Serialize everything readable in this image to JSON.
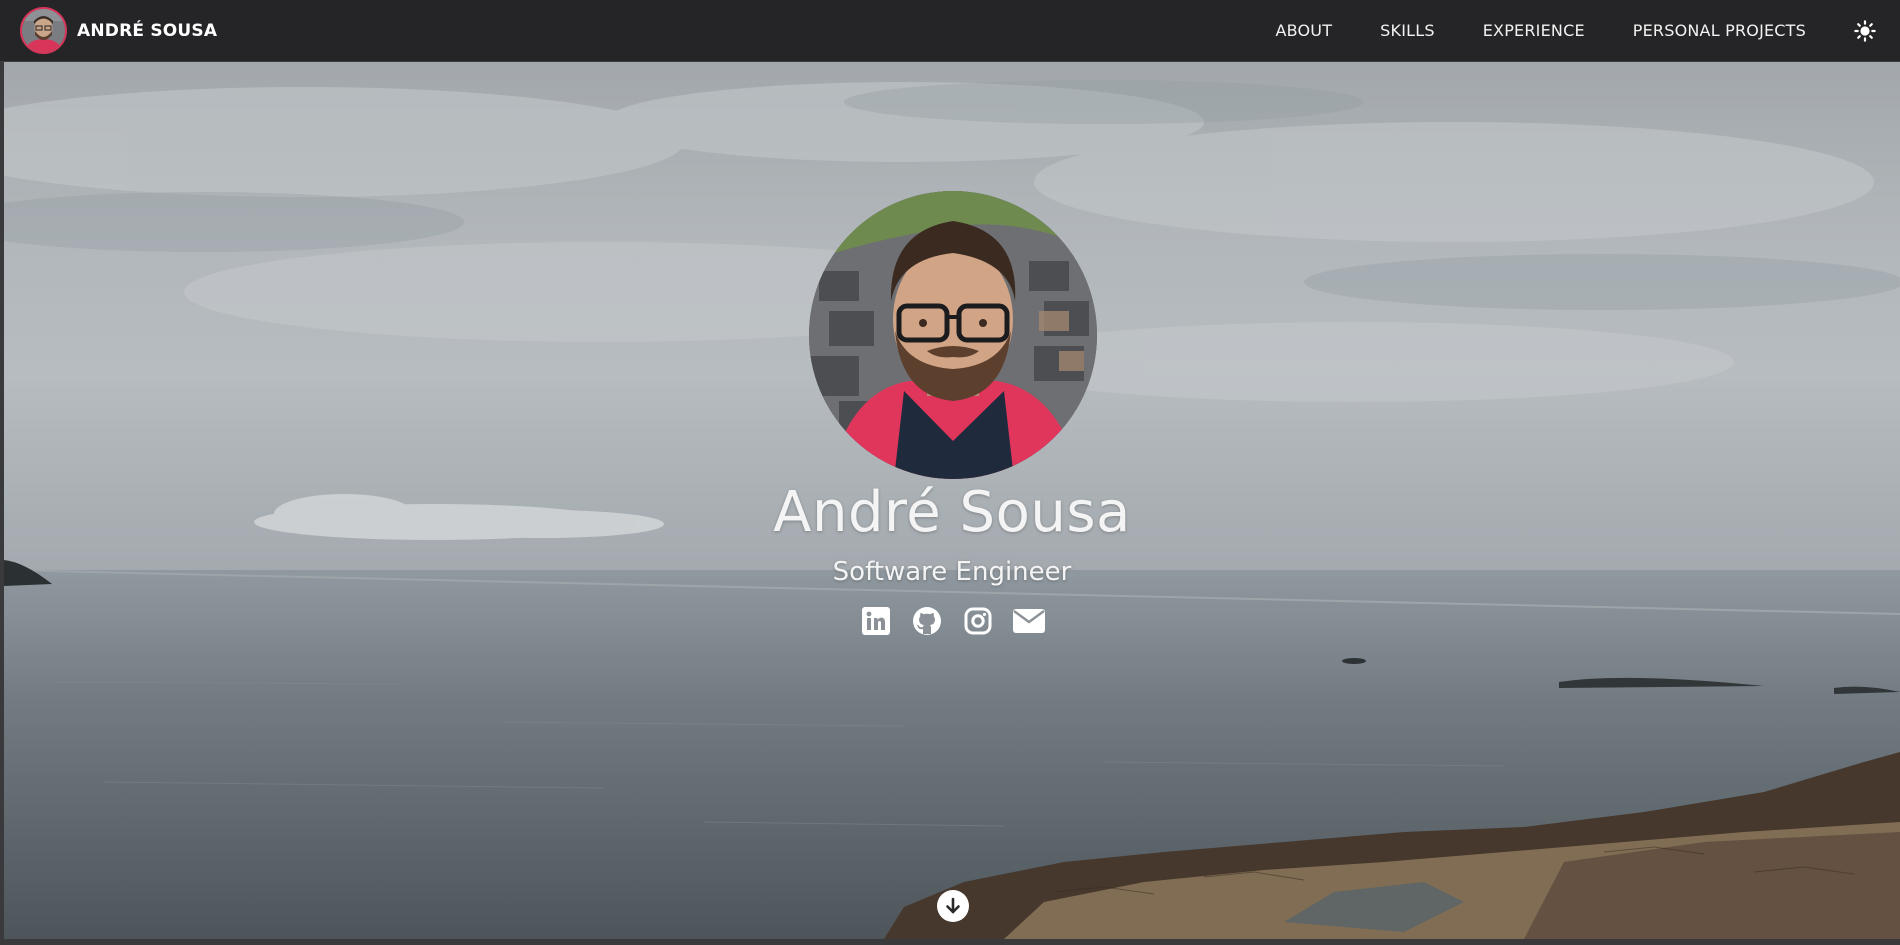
{
  "navbar": {
    "brand_name": "ANDRÉ SOUSA",
    "links": [
      {
        "label": "ABOUT"
      },
      {
        "label": "SKILLS"
      },
      {
        "label": "EXPERIENCE"
      },
      {
        "label": "PERSONAL PROJECTS"
      }
    ],
    "theme_toggle_icon": "sun-icon"
  },
  "hero": {
    "name": "André Sousa",
    "role": "Software Engineer",
    "social_icons": [
      "linkedin-icon",
      "github-icon",
      "instagram-icon",
      "envelope-icon"
    ],
    "scroll_icon": "arrow-down-icon"
  },
  "colors": {
    "navbar_bg": "#252527",
    "accent_ring": "#d9355a",
    "text_light": "#f4f4f4"
  }
}
